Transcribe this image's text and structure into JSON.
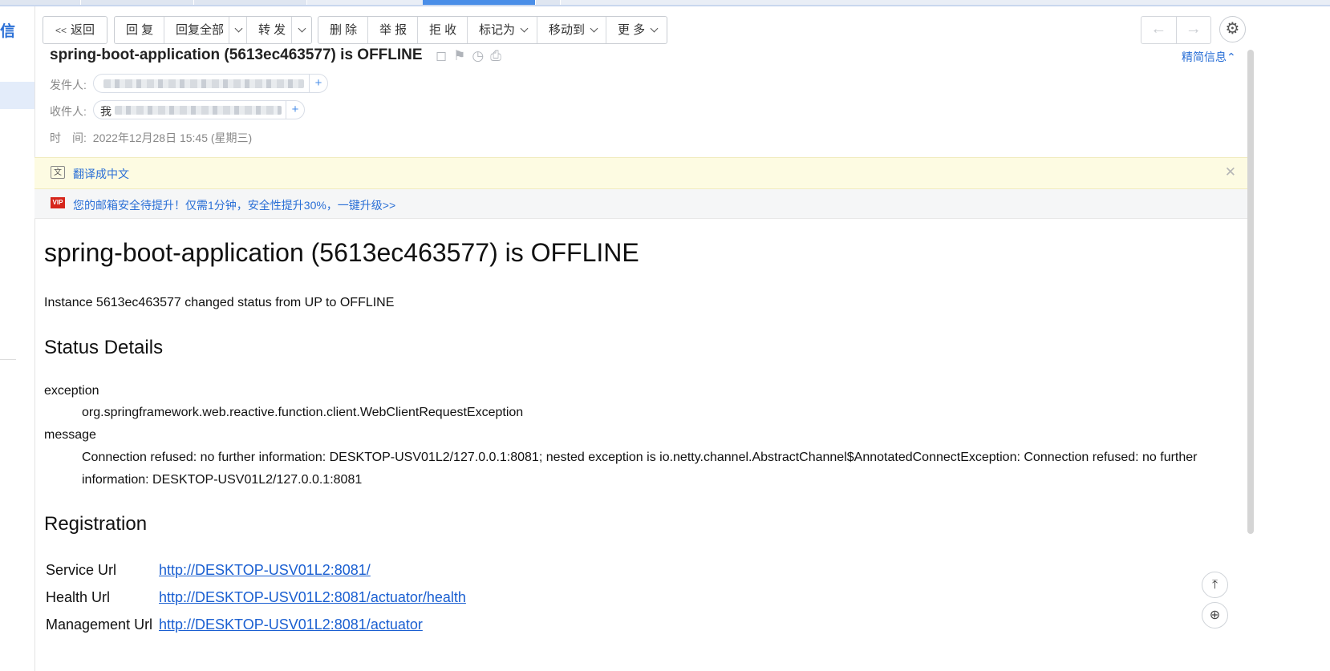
{
  "sidebar": {
    "title": "信"
  },
  "toolbar": {
    "back": "返回",
    "reply": "回 复",
    "reply_all": "回复全部",
    "forward": "转 发",
    "delete": "删 除",
    "report": "举 报",
    "reject": "拒 收",
    "mark_as": "标记为",
    "move_to": "移动到",
    "more": "更 多"
  },
  "header": {
    "subject": "spring-boot-application (5613ec463577) is OFFLINE",
    "brief_info": "精简信息",
    "from_label": "发件人:",
    "to_label": "收件人:",
    "to_first_char": "我",
    "time_label": "时　间:",
    "time_value": "2022年12月28日 15:45 (星期三)"
  },
  "translate_bar": {
    "text": "翻译成中文"
  },
  "vip_bar": {
    "badge": "VIP",
    "text": "您的邮箱安全待提升！仅需1分钟，安全性提升30%，一键升级>>"
  },
  "content": {
    "title": "spring-boot-application (5613ec463577) is OFFLINE",
    "intro": "Instance 5613ec463577 changed status from UP to OFFLINE",
    "status_heading": "Status Details",
    "exception_label": "exception",
    "exception_value": "org.springframework.web.reactive.function.client.WebClientRequestException",
    "message_label": "message",
    "message_value": "Connection refused: no further information: DESKTOP-USV01L2/127.0.0.1:8081; nested exception is io.netty.channel.AbstractChannel$AnnotatedConnectException: Connection refused: no further information: DESKTOP-USV01L2/127.0.0.1:8081",
    "registration_heading": "Registration",
    "registration": [
      {
        "label": "Service Url",
        "value": "http://DESKTOP-USV01L2:8081/"
      },
      {
        "label": "Health Url",
        "value": "http://DESKTOP-USV01L2:8081/actuator/health"
      },
      {
        "label": "Management Url",
        "value": "http://DESKTOP-USV01L2:8081/actuator"
      }
    ]
  },
  "colors": {
    "accent": "#2a6fd6",
    "link": "#1a5fd1",
    "translate_bg": "#fdfbe2",
    "vip_red": "#d6261b"
  }
}
